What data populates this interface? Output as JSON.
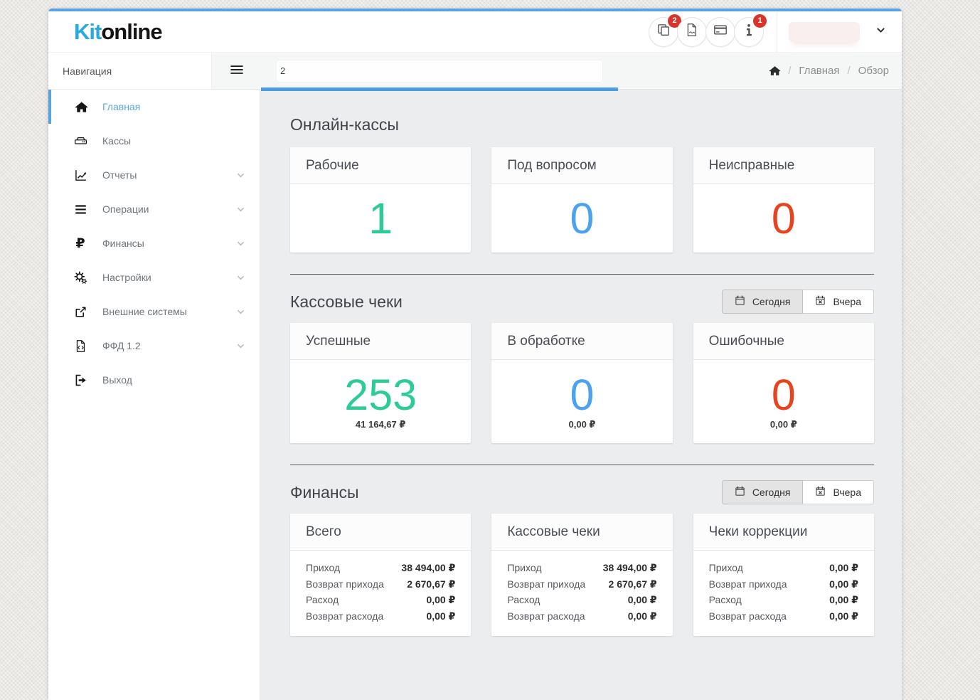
{
  "brand": {
    "logo_primary": "Kit",
    "logo_secondary": "online"
  },
  "colors": {
    "accent_blue": "#57a3e2",
    "value_green": "#2dcc96",
    "value_blue": "#4da2f0",
    "value_red": "#e8431f",
    "badge_red": "#d9342b"
  },
  "header": {
    "actions": [
      {
        "icon": "copy-icon",
        "badge": "2"
      },
      {
        "icon": "file-pdf-icon",
        "badge": ""
      },
      {
        "icon": "credit-card-icon",
        "badge": ""
      },
      {
        "icon": "info-icon",
        "badge": "1"
      }
    ],
    "user": {
      "display_name": ""
    }
  },
  "subheader": {
    "nav_title": "Навигация",
    "company_field_value": "2",
    "breadcrumb": {
      "separator": "/",
      "items": [
        "Главная",
        "Обзор"
      ]
    }
  },
  "icons": {
    "ruble_glyph": "₽"
  },
  "sidebar": {
    "items": [
      {
        "label": "Главная"
      },
      {
        "label": "Кассы"
      },
      {
        "label": "Отчеты"
      },
      {
        "label": "Операции"
      },
      {
        "label": "Финансы"
      },
      {
        "label": "Настройки"
      },
      {
        "label": "Внешние системы"
      },
      {
        "label": "ФФД 1.2"
      },
      {
        "label": "Выход"
      }
    ]
  },
  "sections": {
    "online_kassy": {
      "title": "Онлайн-кассы",
      "cards": [
        {
          "label": "Рабочие",
          "value": "1"
        },
        {
          "label": "Под вопросом",
          "value": "0"
        },
        {
          "label": "Неисправные",
          "value": "0"
        }
      ]
    },
    "kassovye_cheki": {
      "title": "Кассовые чеки",
      "filter": {
        "today": "Сегодня",
        "yesterday": "Вчера"
      },
      "cards": [
        {
          "label": "Успешные",
          "value": "253",
          "amount": "41 164,67 ₽"
        },
        {
          "label": "В обработке",
          "value": "0",
          "amount": "0,00 ₽"
        },
        {
          "label": "Ошибочные",
          "value": "0",
          "amount": "0,00 ₽"
        }
      ]
    },
    "finansy": {
      "title": "Финансы",
      "filter": {
        "today": "Сегодня",
        "yesterday": "Вчера"
      },
      "cards": [
        {
          "label": "Всего",
          "rows": [
            {
              "label": "Приход",
              "value": "38 494,00 ₽"
            },
            {
              "label": "Возврат прихода",
              "value": "2 670,67 ₽"
            },
            {
              "label": "Расход",
              "value": "0,00 ₽"
            },
            {
              "label": "Возврат расхода",
              "value": "0,00 ₽"
            }
          ]
        },
        {
          "label": "Кассовые чеки",
          "rows": [
            {
              "label": "Приход",
              "value": "38 494,00 ₽"
            },
            {
              "label": "Возврат прихода",
              "value": "2 670,67 ₽"
            },
            {
              "label": "Расход",
              "value": "0,00 ₽"
            },
            {
              "label": "Возврат расхода",
              "value": "0,00 ₽"
            }
          ]
        },
        {
          "label": "Чеки коррекции",
          "rows": [
            {
              "label": "Приход",
              "value": "0,00 ₽"
            },
            {
              "label": "Возврат прихода",
              "value": "0,00 ₽"
            },
            {
              "label": "Расход",
              "value": "0,00 ₽"
            },
            {
              "label": "Возврат расхода",
              "value": "0,00 ₽"
            }
          ]
        }
      ]
    }
  }
}
